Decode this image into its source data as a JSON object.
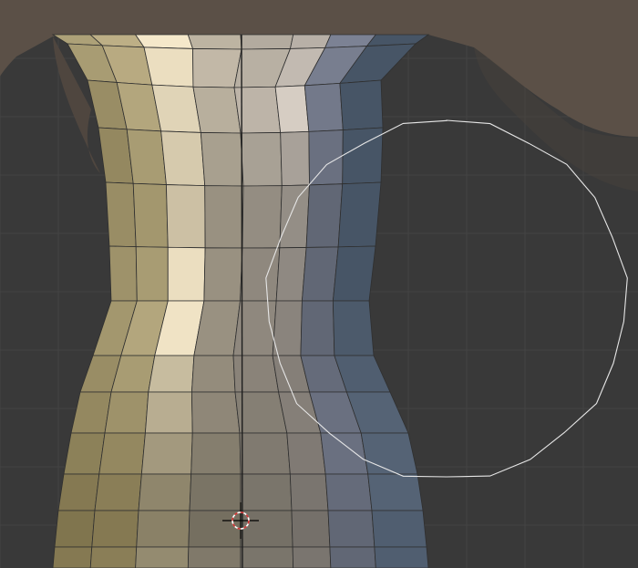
{
  "viewport": {
    "background": "#393939",
    "grid_color": "#444444",
    "reference_skin_color": "#5b5047",
    "mesh_edge_color": "#2f2f2f",
    "center_seam_color": "#1e1e1e",
    "brush_circle_color": "#e6e6e6",
    "cursor_3d_colors": [
      "#d03030",
      "#ffffff"
    ],
    "mesh_shading": "solid-faceted",
    "icons": [
      "3d-cursor-icon",
      "sculpt-brush-circle-icon"
    ]
  }
}
